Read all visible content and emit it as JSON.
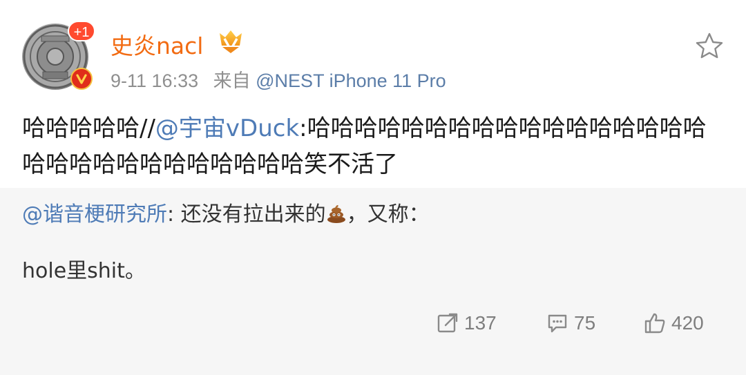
{
  "post": {
    "user": {
      "name": "史炎nacl",
      "badge_count": "+1",
      "name_color": "#f26b12"
    },
    "time": "9-11 16:33",
    "source_label": "来自",
    "source_device": "@NEST iPhone 11 Pro",
    "text_prefix": "哈哈哈哈哈//",
    "mention": "@宇宙vDuck",
    "text_suffix": ":哈哈哈哈哈哈哈哈哈哈哈哈哈哈哈哈哈哈哈哈哈哈哈哈哈哈哈哈哈笑不活了",
    "accent_color": "#4e7bb6"
  },
  "retweet": {
    "mention": "@谐音梗研究所",
    "text_a": ": 还没有拉出来的",
    "emoji_icon": "poop-icon",
    "text_b": "，又称：",
    "line2": "hole里shit。"
  },
  "actions": {
    "repost_count": "137",
    "comment_count": "75",
    "like_count": "420",
    "icons": [
      "share-icon",
      "comment-icon",
      "like-icon"
    ]
  }
}
